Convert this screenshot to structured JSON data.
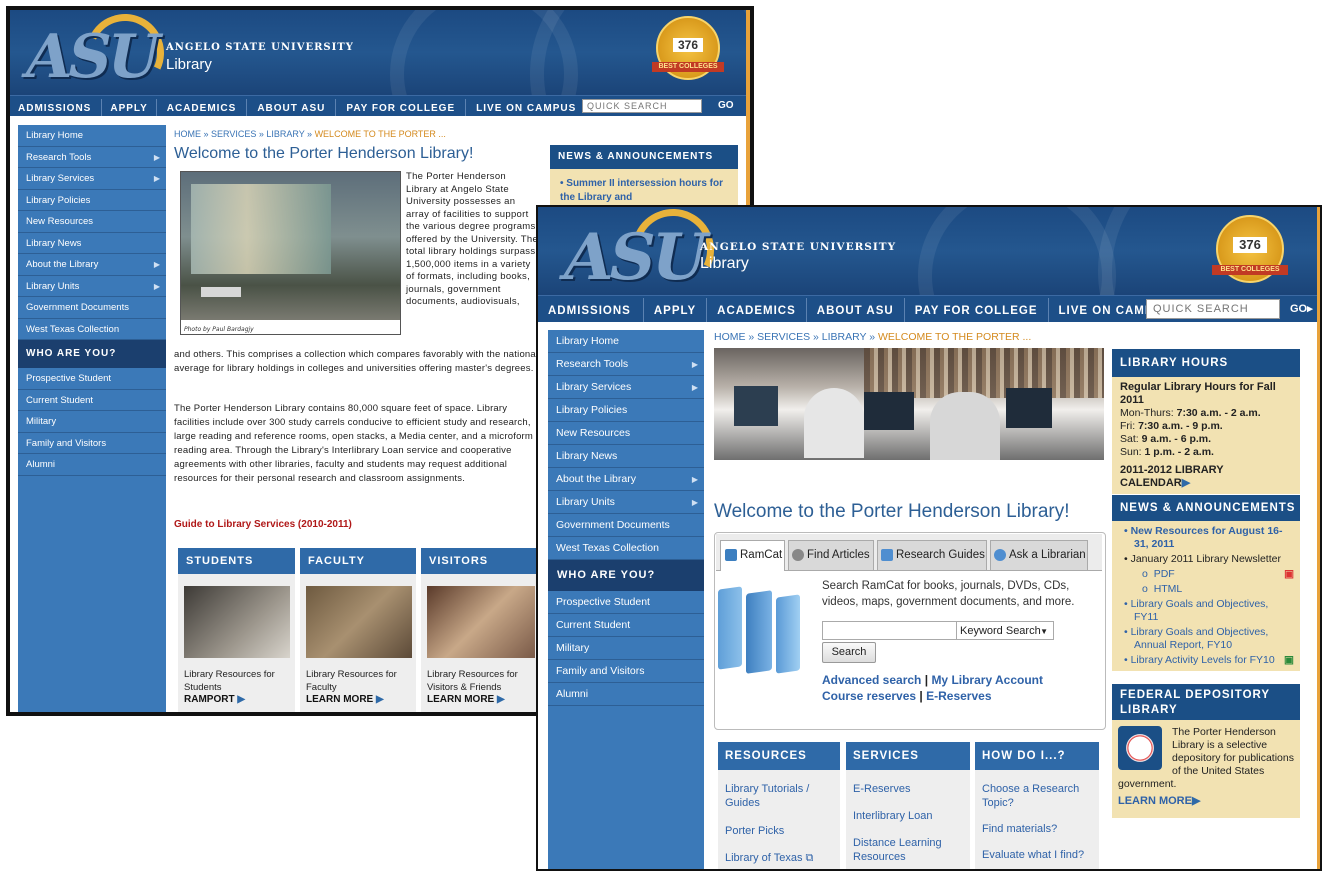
{
  "brand": {
    "logo": "ASU",
    "university": "ANGELO STATE UNIVERSITY",
    "library": "Library",
    "badge_number": "376",
    "badge_ribbon": "BEST COLLEGES"
  },
  "topnav": {
    "items": [
      "ADMISSIONS",
      "APPLY",
      "ACADEMICS",
      "ABOUT ASU",
      "PAY FOR COLLEGE",
      "LIVE ON CAMPUS"
    ],
    "quick_search_placeholder": "QUICK SEARCH",
    "go": "GO"
  },
  "sidebar": {
    "items": [
      {
        "label": "Library Home",
        "arrow": ""
      },
      {
        "label": "Research Tools",
        "arrow": "▶"
      },
      {
        "label": "Library Services",
        "arrow": "▶"
      },
      {
        "label": "Library Policies",
        "arrow": ""
      },
      {
        "label": "New Resources",
        "arrow": ""
      },
      {
        "label": "Library News",
        "arrow": ""
      },
      {
        "label": "About the Library",
        "arrow": "▶"
      },
      {
        "label": "Library Units",
        "arrow": "▶"
      },
      {
        "label": "Government Documents",
        "arrow": ""
      },
      {
        "label": "West Texas Collection",
        "arrow": ""
      }
    ],
    "who_header": "WHO ARE YOU?",
    "who_items": [
      "Prospective Student",
      "Current Student",
      "Military",
      "Family and Visitors",
      "Alumni"
    ]
  },
  "old_page": {
    "breadcrumb": "HOME » SERVICES » LIBRARY » ",
    "breadcrumb_current": "WELCOME TO THE PORTER ...",
    "title": "Welcome to the Porter Henderson Library!",
    "photo_credit": "Photo by Paul Bardagjy",
    "para1_side": "The Porter Henderson Library at Angelo State University possesses an array of facilities to support the various degree programs offered by the University. The total library holdings surpass 1,500,000 items in a variety of formats, including books, journals, government documents, audiovisuals,",
    "para1_rest": "and others. This comprises a collection which compares favorably with the national average for library holdings in colleges and universities offering master's degrees.",
    "para2": "The Porter Henderson Library contains 80,000 square feet of space. Library facilities include over 300 study carrels conducive to efficient study and research, large reading and reference rooms, open stacks, a Media center, and a microform reading area. Through the Library's Interlibrary Loan service and cooperative agreements with other libraries, faculty and students may request additional resources for their personal research and classroom assignments.",
    "guide_link": "Guide to Library Services (2010-2011)",
    "news_header": "NEWS & ANNOUNCEMENTS",
    "news_item": "Summer II intersession hours for the Library and",
    "columns": [
      {
        "header": "STUDENTS",
        "caption": "Library Resources for Students",
        "more": "RAMPORT"
      },
      {
        "header": "FACULTY",
        "caption": "Library Resources for Faculty",
        "more": "LEARN MORE"
      },
      {
        "header": "VISITORS",
        "caption": "Library Resources for Visitors & Friends",
        "more": "LEARN MORE"
      }
    ]
  },
  "new_page": {
    "breadcrumb": "HOME » SERVICES » LIBRARY » ",
    "breadcrumb_current": "WELCOME TO THE PORTER ...",
    "title": "Welcome to the Porter Henderson Library!",
    "tabs": [
      "RamCat",
      "Find Articles",
      "Research Guides",
      "Ask a Librarian"
    ],
    "search_desc": "Search RamCat for books, journals, DVDs, CDs, videos, maps, government documents, and more.",
    "search_value": "",
    "search_type": "Keyword Search",
    "search_button": "Search",
    "advanced_search": "Advanced search",
    "my_account": "My Library Account",
    "course_reserves": "Course reserves",
    "e_reserves": "E-Reserves",
    "separator": "|",
    "hours": {
      "header": "LIBRARY HOURS",
      "subtitle": "Regular Library Hours for Fall 2011",
      "rows": [
        {
          "day": "Mon-Thurs: ",
          "time": "7:30 a.m. - 2 a.m."
        },
        {
          "day": "Fri: ",
          "time": "7:30 a.m. - 9 p.m."
        },
        {
          "day": "Sat: ",
          "time": "9 a.m. - 6 p.m."
        },
        {
          "day": "Sun: ",
          "time": "1 p.m. - 2 a.m."
        }
      ],
      "calendar": "2011-2012 LIBRARY CALENDAR"
    },
    "news": {
      "header": "NEWS & ANNOUNCEMENTS",
      "item1": "New Resources for August 16-31, 2011",
      "item2": "January 2011 Library Newsletter",
      "sub1": "PDF",
      "sub2": "HTML",
      "item3": "Library Goals and Objectives, FY11",
      "item4": "Library Goals and Objectives, Annual Report, FY10",
      "item5": "Library Activity Levels for FY10"
    },
    "fdl": {
      "header": "FEDERAL DEPOSITORY LIBRARY",
      "text": "The Porter Henderson Library is a selective depository for publications of the United States government.",
      "more": "LEARN MORE"
    },
    "columns": [
      {
        "header": "RESOURCES",
        "links": [
          "Library Tutorials / Guides",
          "Porter Picks",
          "Library of Texas"
        ]
      },
      {
        "header": "SERVICES",
        "links": [
          "E-Reserves",
          "Interlibrary Loan",
          "Distance Learning Resources"
        ]
      },
      {
        "header": "HOW DO I...?",
        "links": [
          "Choose a Research Topic?",
          "Find materials?",
          "Evaluate what I find?"
        ]
      }
    ]
  }
}
